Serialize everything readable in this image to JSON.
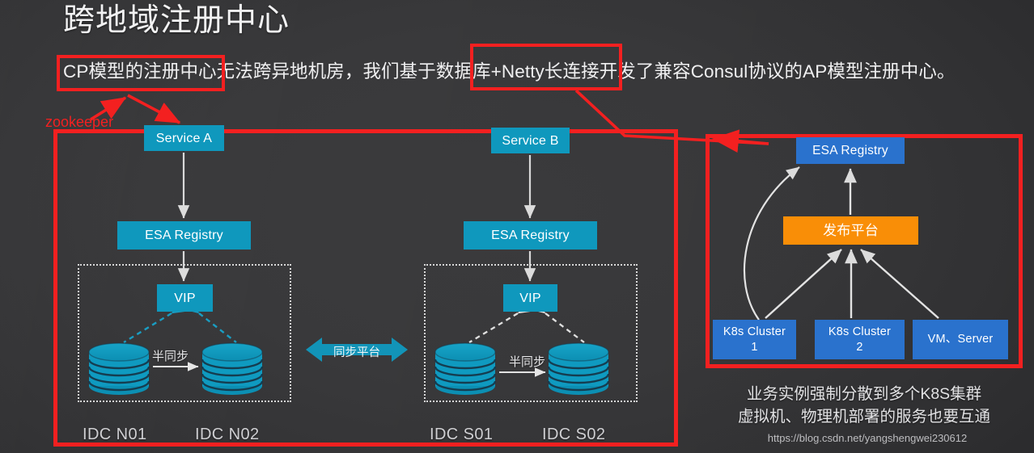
{
  "slide": {
    "title": "跨地域注册中心",
    "headline": "CP模型的注册中心无法跨异地机房，我们基于数据库+Netty长连接开发了兼容Consul协议的AP模型注册中心。",
    "annotation_label": "zookeeper",
    "watermark": "https://blog.csdn.net/yangshengwei230612"
  },
  "colors": {
    "teal": "#0f98bd",
    "blue": "#2a72cd",
    "orange": "#f98e07",
    "annotation_red": "#f32020",
    "background": "#39393b",
    "text": "#e9e9ea"
  },
  "left_panel": {
    "column_a": {
      "service": "Service A",
      "registry": "ESA Registry",
      "vip": "VIP",
      "sync_label": "半同步",
      "idc_left": "IDC N01",
      "idc_right": "IDC N02"
    },
    "column_b": {
      "service": "Service B",
      "registry": "ESA Registry",
      "vip": "VIP",
      "sync_label": "半同步",
      "idc_left": "IDC S01",
      "idc_right": "IDC S02"
    },
    "sync_platform": "同步平台"
  },
  "right_panel": {
    "registry": "ESA Registry",
    "publish_platform": "发布平台",
    "nodes": [
      {
        "line1": "K8s Cluster",
        "line2": "1"
      },
      {
        "line1": "K8s Cluster",
        "line2": "2"
      },
      {
        "line1": "VM、Server",
        "line2": ""
      }
    ],
    "caption_line1": "业务实例强制分散到多个K8S集群",
    "caption_line2": "虚拟机、物理机部署的服务也要互通"
  }
}
